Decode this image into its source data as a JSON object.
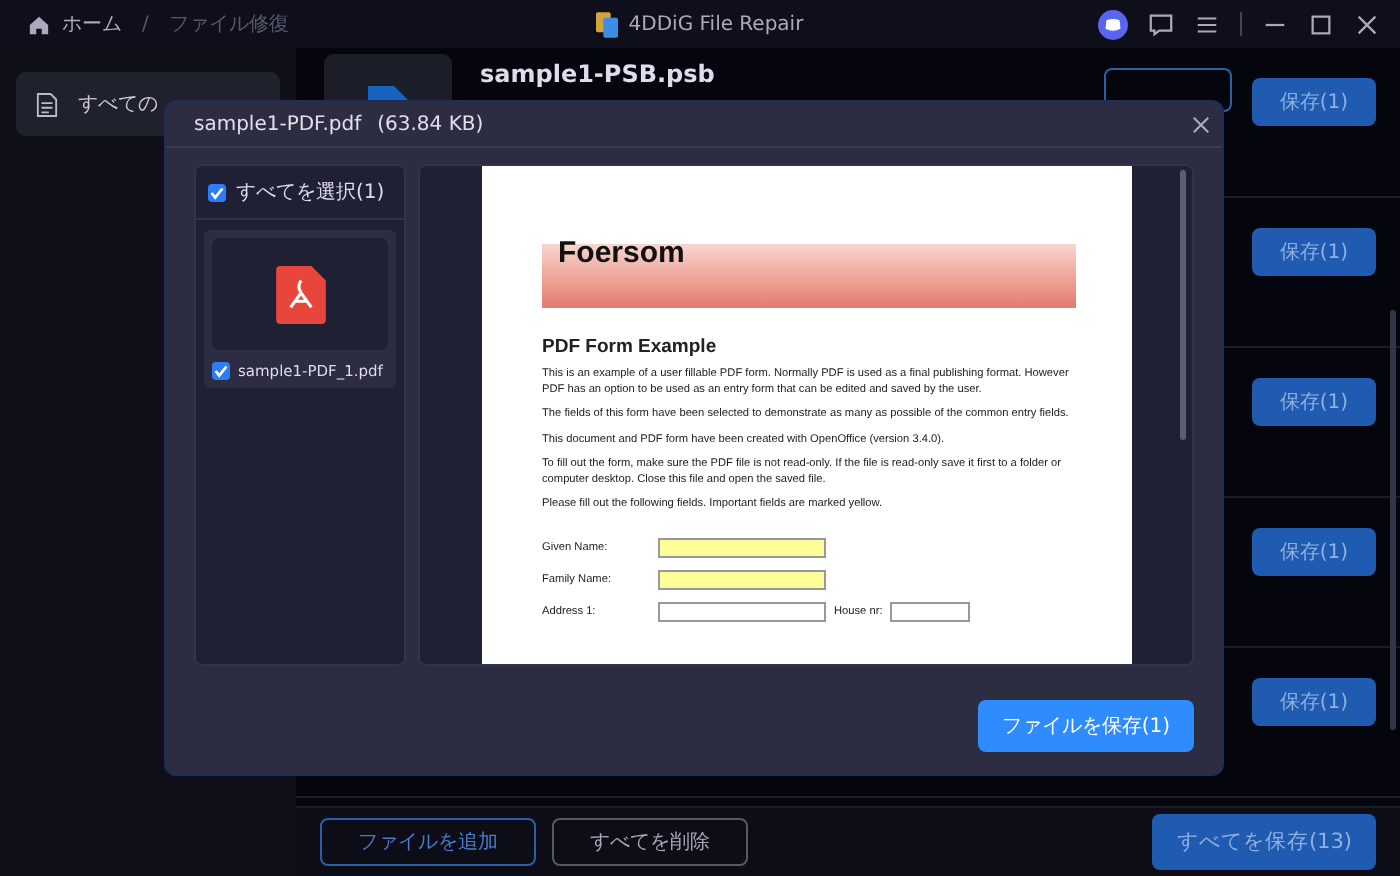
{
  "titlebar": {
    "breadcrumbs": [
      {
        "label": "ホーム",
        "selected": false
      },
      {
        "label": "ファイル修復",
        "selected": true
      }
    ],
    "separator": "/",
    "title": "4DDiG File Repair"
  },
  "sidebar": {
    "items": [
      {
        "label": "すべての",
        "selected": true
      }
    ]
  },
  "file_list": {
    "rows": [
      {
        "name": "sample1-PSB.psb",
        "has_preview_button": true,
        "save_button": "保存(1)"
      },
      {
        "save_button": "保存(1)"
      },
      {
        "save_button": "保存(1)"
      },
      {
        "save_button": "保存(1)"
      },
      {
        "save_button": "保存(1)"
      }
    ]
  },
  "bottom_bar": {
    "add_button": "ファイルを追加",
    "delete_button": "すべてを削除",
    "save_all_button": "すべてを保存(13)"
  },
  "dialog": {
    "title": "sample1-PDF.pdf",
    "size": "(63.84 KB)",
    "select_all": {
      "label": "すべてを選択(1)",
      "checked": true
    },
    "files": [
      {
        "name": "sample1-PDF_1.pdf",
        "checked": true,
        "selected": true
      }
    ],
    "document": {
      "logo": "Foersom",
      "heading": "PDF Form Example",
      "paragraphs": [
        "This is an example of a user fillable PDF form. Normally PDF is used as a final publishing format. However PDF has an option to be used as an entry form that can be edited and saved by the user.",
        "The fields of this form have been selected to demonstrate as many as possible of the common entry fields.",
        "This document and PDF form have been created with OpenOffice (version 3.4.0).",
        "To fill out the form, make sure the PDF file is not read-only. If the file is read-only save it first to a folder or computer desktop. Close this file and open the saved file.",
        "Please fill out the following fields. Important fields are marked yellow."
      ],
      "fields": [
        {
          "label": "Given Name:",
          "kind": "important"
        },
        {
          "label": "Family Name:",
          "kind": "important"
        },
        {
          "label": "Address 1:",
          "kind": "normal",
          "extra_label": "House nr:"
        }
      ]
    },
    "save_button": "ファイルを保存(1)"
  }
}
